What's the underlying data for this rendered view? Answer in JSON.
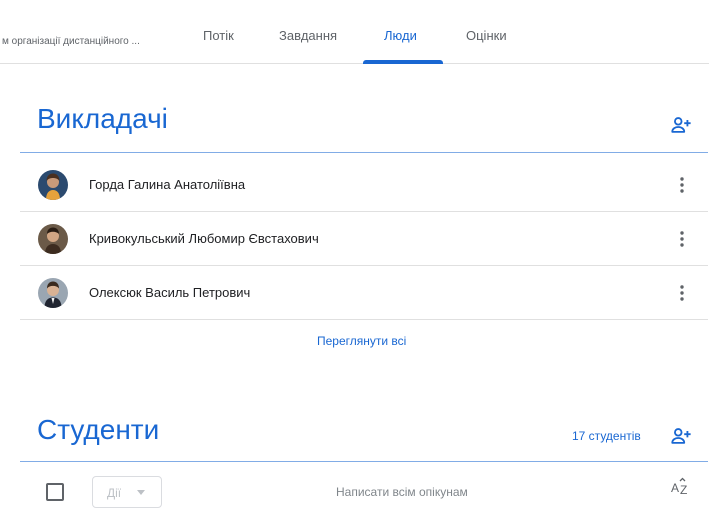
{
  "header": {
    "course_name": "м організації дистанційного ...",
    "tabs": [
      {
        "label": "Потік"
      },
      {
        "label": "Завдання"
      },
      {
        "label": "Люди"
      },
      {
        "label": "Оцінки"
      }
    ],
    "active_tab": "Люди"
  },
  "teachers": {
    "title": "Викладачі",
    "add_icon": "person-add-icon",
    "people": [
      {
        "name": "Горда Галина Анатоліївна"
      },
      {
        "name": "Кривокульський Любомир Євстахович"
      },
      {
        "name": "Олексюк Василь Петрович"
      }
    ],
    "view_all_label": "Переглянути всі"
  },
  "students": {
    "title": "Студенти",
    "count_label": "17 студентів",
    "add_icon": "person-add-icon",
    "actions_label": "Дії",
    "email_all_label": "Написати всім опікунам",
    "sort_icon": "sort-az-icon"
  },
  "colors": {
    "accent": "#1967d2",
    "divider": "#e0e0e0",
    "text": "#202124",
    "muted": "#5f6368"
  }
}
